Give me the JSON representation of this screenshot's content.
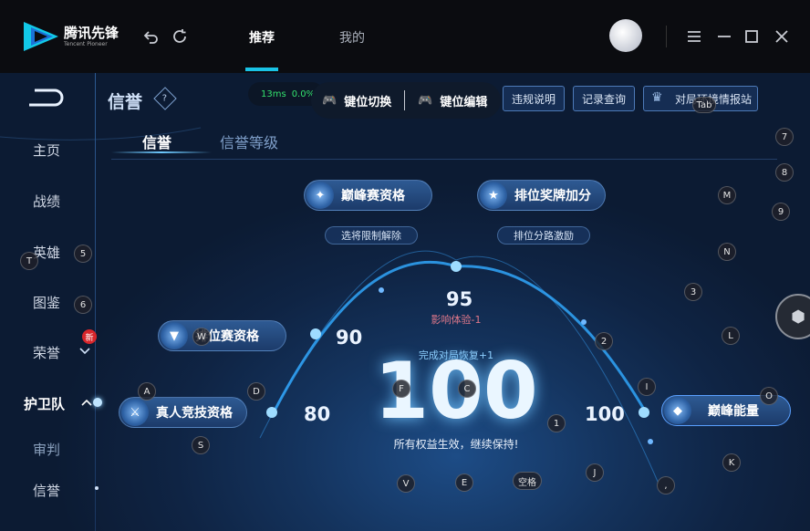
{
  "app": {
    "logo_text": "腾讯先锋",
    "logo_sub": "Tencent Pioneer"
  },
  "topnav": {
    "tabs": [
      {
        "label": "推荐",
        "active": true
      },
      {
        "label": "我的",
        "active": false
      }
    ]
  },
  "page": {
    "title": "信誉",
    "help_glyph": "?"
  },
  "network": {
    "latency": "13ms",
    "loss": "0.0%"
  },
  "keymapping": {
    "switch_label": "键位切换",
    "edit_label": "键位编辑"
  },
  "toolbar": {
    "violation_label": "违规说明",
    "record_label": "记录查询",
    "env_label": "对局环境情报站"
  },
  "subtabs": [
    {
      "label": "信誉",
      "active": true
    },
    {
      "label": "信誉等级",
      "active": false
    }
  ],
  "sidebar": {
    "items": [
      {
        "label": "主页"
      },
      {
        "label": "战绩"
      },
      {
        "label": "英雄"
      },
      {
        "label": "图鉴"
      },
      {
        "label": "荣誉",
        "badge": "新"
      },
      {
        "label": "护卫队"
      },
      {
        "label": "审判"
      },
      {
        "label": "信誉"
      }
    ]
  },
  "privileges": {
    "peak": {
      "label": "巅峰赛资格",
      "sub": "选将限制解除"
    },
    "rank_bonus": {
      "label": "排位奖牌加分",
      "sub": "排位分路激励"
    },
    "ranked": {
      "label": "排位赛资格"
    },
    "real_player": {
      "label": "真人竞技资格"
    },
    "peak_energy": {
      "label": "巅峰能量"
    }
  },
  "score": {
    "value": "100",
    "impact": "影响体验-1",
    "recovery": "完成对局恢复+1",
    "status": "所有权益生效，继续保持!",
    "levels": [
      "80",
      "90",
      "95",
      "100"
    ]
  },
  "hotkeys": [
    "Tab",
    "7",
    "8",
    "M",
    "9",
    "N",
    "3",
    "2",
    "L",
    "I",
    "O",
    "1",
    "J",
    "K",
    ",",
    "T",
    "5",
    "6",
    "W",
    "A",
    "D",
    "F",
    "C",
    "S",
    "V",
    "E",
    "空格"
  ],
  "colors": {
    "accent": "#19c3e6",
    "score_blue": "#8fd0ff",
    "badge_red": "#d7262b",
    "peak_energy_border": "#5aa0ff"
  }
}
